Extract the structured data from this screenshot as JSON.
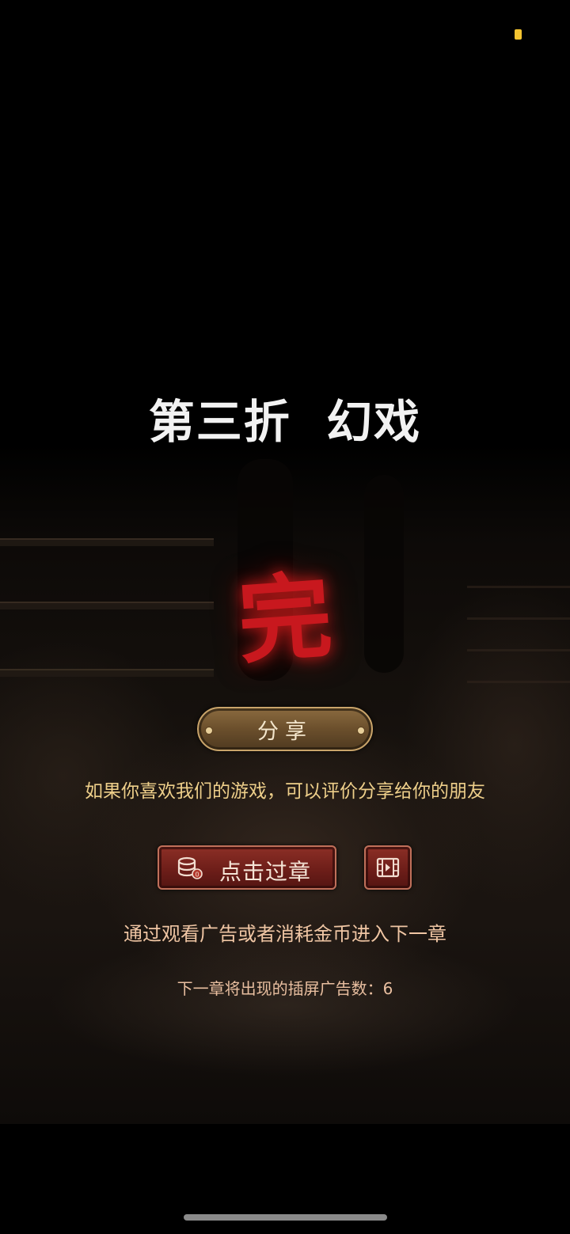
{
  "chapter": {
    "title": "第三折  幻戏",
    "finish_mark": "完"
  },
  "share": {
    "button_label": "分享",
    "hint": "如果你喜欢我们的游戏，可以评价分享给你的朋友"
  },
  "skip": {
    "button_label": "点击过章",
    "coin_icon": "coin-stack-icon",
    "video_icon": "video-film-icon",
    "hint": "通过观看广告或者消耗金币进入下一章"
  },
  "ads": {
    "label": "下一章将出现的插屏广告数：",
    "count": "6",
    "full_text": "下一章将出现的插屏广告数：6"
  },
  "colors": {
    "finish_mark": "#c8181e",
    "share_button": "#6b4f2c",
    "skip_button": "#6e1e19",
    "share_hint": "#eecf8a",
    "status_dot": "#f4c430"
  }
}
